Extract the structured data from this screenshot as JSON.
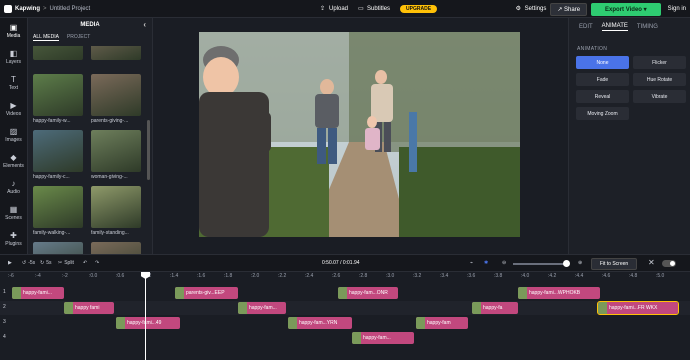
{
  "topbar": {
    "brand": "Kapwing",
    "separator": ">",
    "project": "Untitled Project",
    "upload": "Upload",
    "subtitles": "Subtitles",
    "upgrade": "UPGRADE",
    "settings": "Settings",
    "share": "Share",
    "export": "Export Video",
    "signin": "Sign in"
  },
  "rail": {
    "items": [
      {
        "label": "Media",
        "icon": "media-icon"
      },
      {
        "label": "Layers",
        "icon": "layers-icon"
      },
      {
        "label": "Text",
        "icon": "text-icon"
      },
      {
        "label": "Videos",
        "icon": "videos-icon"
      },
      {
        "label": "Images",
        "icon": "images-icon"
      },
      {
        "label": "Elements",
        "icon": "elements-icon"
      },
      {
        "label": "Audio",
        "icon": "audio-icon"
      },
      {
        "label": "Scenes",
        "icon": "scenes-icon"
      },
      {
        "label": "Plugins",
        "icon": "plugins-icon"
      }
    ]
  },
  "media": {
    "title": "MEDIA",
    "tabs": [
      "ALL MEDIA",
      "PROJECT"
    ],
    "thumbs": [
      {
        "label": "",
        "color": "#5c6f4a"
      },
      {
        "label": "",
        "color": "#8a7766"
      },
      {
        "label": "happy-family-w...",
        "color": "#5d7d4a"
      },
      {
        "label": "parents-giving-...",
        "color": "#7b6a5a"
      },
      {
        "label": "happy-family-c...",
        "color": "#4d6b7a"
      },
      {
        "label": "woman-giving-...",
        "color": "#6e7f5c"
      },
      {
        "label": "family-walking-...",
        "color": "#6a8a4a"
      },
      {
        "label": "family-standing...",
        "color": "#8f9a6a"
      },
      {
        "label": "",
        "color": "#667b8a"
      },
      {
        "label": "",
        "color": "#7a6a5a"
      }
    ]
  },
  "right_panel": {
    "tabs": [
      "EDIT",
      "ANIMATE",
      "TIMING"
    ],
    "active_tab": "ANIMATE",
    "section_title": "ANIMATION",
    "animations": [
      "None",
      "Flicker",
      "Fade",
      "Hue Rotate",
      "Reveal",
      "Vibrate",
      "Moving Zoom"
    ],
    "selected": "None"
  },
  "transport": {
    "back5": "-5s",
    "fwd5": "5s",
    "split": "Split",
    "timecode": "0:50.07 / 0:01.94",
    "fit_screen": "Fit to Screen"
  },
  "ruler": {
    "ticks": [
      ":-6",
      ":-4",
      ":-2",
      ":0.0",
      ":0.6",
      ":1.2",
      ":1.4",
      ":1.6",
      ":1.8",
      ":2.0",
      ":2.2",
      ":2.4",
      ":2.6",
      ":2.8",
      ":3.0",
      ":3.2",
      ":3.4",
      ":3.6",
      ":3.8",
      ":4.0",
      ":4.2",
      ":4.4",
      ":4.6",
      ":4.8",
      ":5.0"
    ]
  },
  "tracks": [
    {
      "number": "1",
      "clips": [
        {
          "label": "happy-fami...",
          "style": "pink"
        },
        {
          "label": "parents-giv...EEP",
          "style": "pink"
        },
        {
          "label": "happy-fam...ONR",
          "style": "pink"
        },
        {
          "label": "happy-fami...WPHOKB",
          "style": "pink"
        }
      ]
    },
    {
      "number": "2",
      "clips": [
        {
          "label": "happy fami",
          "style": "pink"
        },
        {
          "label": "happy-fam...",
          "style": "pink"
        },
        {
          "label": "happy-fa",
          "style": "pink"
        },
        {
          "label": "happy-fami...FR WKX",
          "style": "yellow"
        }
      ]
    },
    {
      "number": "3",
      "clips": [
        {
          "label": "happy-fami...49",
          "style": "pink"
        },
        {
          "label": "happy-fam...YRN",
          "style": "pink"
        },
        {
          "label": "happy-fam",
          "style": "pink"
        }
      ]
    },
    {
      "number": "4",
      "clips": [
        {
          "label": "happy-fam...",
          "style": "pink"
        }
      ]
    }
  ]
}
